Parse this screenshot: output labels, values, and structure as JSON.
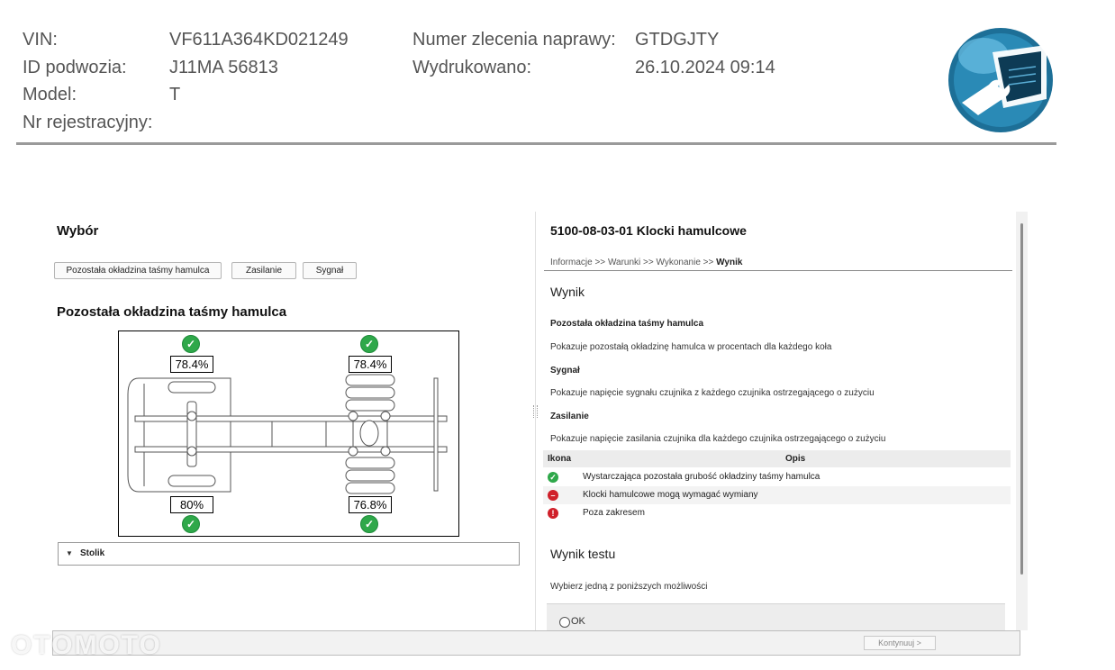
{
  "header": {
    "vin_label": "VIN:",
    "vin_value": "VF611A364KD021249",
    "chassis_label": "ID podwozia:",
    "chassis_value": "J11MA 56813",
    "model_label": "Model:",
    "model_value": "T",
    "reg_label": "Nr rejestracyjny:",
    "order_label": "Numer zlecenia naprawy:",
    "order_value": "GTDGJTY",
    "printed_label": "Wydrukowano:",
    "printed_value": "26.10.2024 09:14",
    "logo_icon": "diagnostic-tool-logo-icon"
  },
  "left": {
    "title": "Wybór",
    "buttons": [
      "Pozostała okładzina taśmy hamulca",
      "Zasilanie",
      "Sygnał"
    ],
    "section_title": "Pozostała okładzina taśmy hamulca",
    "wheels": {
      "front_left": "78.4%",
      "rear_left": "78.4%",
      "front_right": "80%",
      "rear_right": "76.8%"
    },
    "stolik_label": "Stolik"
  },
  "right": {
    "title": "5100-08-03-01 Klocki hamulcowe",
    "breadcrumb": {
      "steps": [
        "Informacje",
        ">>",
        "Warunki",
        ">>",
        "Wykonanie",
        ">>"
      ],
      "current": "Wynik"
    },
    "result_heading": "Wynik",
    "sections": [
      {
        "heading": "Pozostała okładzina taśmy hamulca",
        "text": "Pokazuje pozostałą okładzinę hamulca w procentach dla każdego koła"
      },
      {
        "heading": "Sygnał",
        "text": "Pokazuje napięcie sygnału czujnika z każdego czujnika ostrzegającego o zużyciu"
      },
      {
        "heading": "Zasilanie",
        "text": "Pokazuje napięcie zasilania czujnika dla każdego czujnika ostrzegającego o zużyciu"
      }
    ],
    "table": {
      "col_icon": "Ikona",
      "col_desc": "Opis",
      "rows": [
        {
          "icon": "check-icon",
          "color": "#2fa84a",
          "text": "Wystarczająca pozostała grubość okładziny taśmy hamulca"
        },
        {
          "icon": "minus-icon",
          "color": "#d0202a",
          "text": "Klocki hamulcowe mogą wymagać wymiany"
        },
        {
          "icon": "exclamation-icon",
          "color": "#d0202a",
          "text": "Poza zakresem"
        }
      ]
    },
    "test_heading": "Wynik testu",
    "test_prompt": "Wybierz jedną z poniższych możliwości",
    "option_ok": "OK"
  },
  "footer": {
    "continue_label": "Kontynuuj >",
    "watermark": "OTOMOTO"
  }
}
